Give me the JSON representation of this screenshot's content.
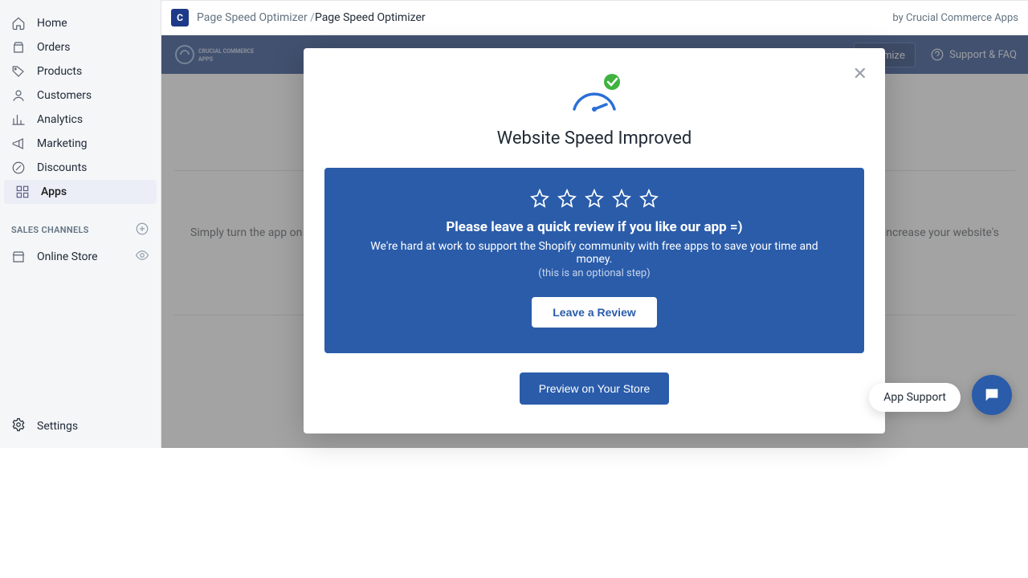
{
  "sidebar": {
    "items": [
      {
        "label": "Home"
      },
      {
        "label": "Orders"
      },
      {
        "label": "Products"
      },
      {
        "label": "Customers"
      },
      {
        "label": "Analytics"
      },
      {
        "label": "Marketing"
      },
      {
        "label": "Discounts"
      },
      {
        "label": "Apps"
      }
    ],
    "section_label": "SALES CHANNELS",
    "channel": "Online Store",
    "settings": "Settings"
  },
  "header": {
    "crumb1": "Page Speed Optimizer",
    "crumb2": "Page Speed Optimizer",
    "by": "by Crucial Commerce Apps"
  },
  "appbar": {
    "brand": "CRUCIAL COMMERCE APPS",
    "optimize": "Optimize",
    "support": "Support & FAQ"
  },
  "bg": {
    "line1": "Simply turn the app on and",
    "line2": "cally increase your website's"
  },
  "modal": {
    "title": "Website Speed Improved",
    "review_prompt": "Please leave a quick review if you like our app =)",
    "sub1": "We're hard at work to support the Shopify community with free apps to save your time and money.",
    "sub2": "(this is an optional step)",
    "leave_btn": "Leave a Review",
    "preview_btn": "Preview on Your Store"
  },
  "chat": {
    "pill": "App Support"
  }
}
